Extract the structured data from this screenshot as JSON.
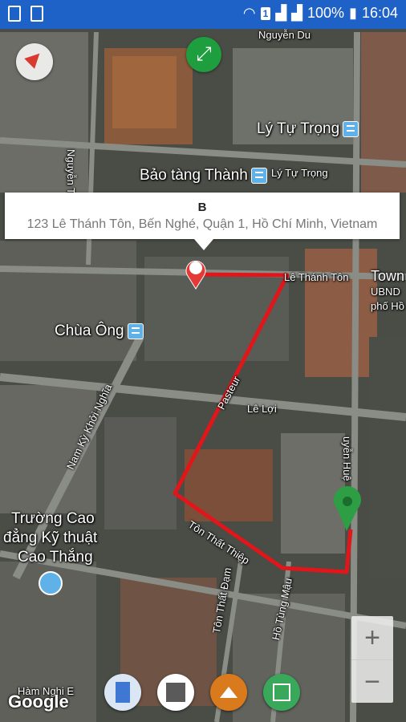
{
  "status_bar": {
    "sim": "1",
    "battery": "100%",
    "time": "16:04"
  },
  "info_window": {
    "title": "B",
    "address": "123 Lê Thánh Tôn, Bến Nghé, Quận 1, Hồ Chí Minh, Vietnam"
  },
  "map_labels": {
    "nguyen_du": "Nguyễn Du",
    "ly_tu_trong_poi": "Lý Tự Trọng",
    "ly_tu_trong_street": "Lý Tự Trọng",
    "bao_tang": "Bảo tàng Thành",
    "nguyen_trung": "Nguyễn Tr",
    "le_thanh_ton": "Lê Thánh Tôn",
    "town": "Town",
    "ubnd": "UBND",
    "pho_ho": "phố Hồ",
    "chua_ong": "Chùa Ông",
    "pasteur": "Pasteur",
    "le_loi": "Lê Lợi",
    "nam_ky": "Nam Kỳ Khởi Nghĩa",
    "nguyen_hue": "uyễn Huệ",
    "truong_cao_1": "Trường Cao",
    "truong_cao_2": "đẳng Kỹ thuật",
    "truong_cao_3": "Cao Thắng",
    "ton_that_thiep": "Tôn Thất Thiệp",
    "ton_that_dam": "Tôn Thất Đạm",
    "ho_tung_mau": "Hồ Tùng Mậu",
    "ham_nghi": "Hàm Nghi E"
  },
  "attribution": "Google",
  "zoom": {
    "in": "+",
    "out": "−"
  },
  "route_color": "#e0161a",
  "marker_colors": {
    "origin": "#e53935",
    "destination": "#2e9e44"
  },
  "buttons": [
    "compass",
    "my-location",
    "map-type",
    "google-maps",
    "photo",
    "gallery"
  ]
}
